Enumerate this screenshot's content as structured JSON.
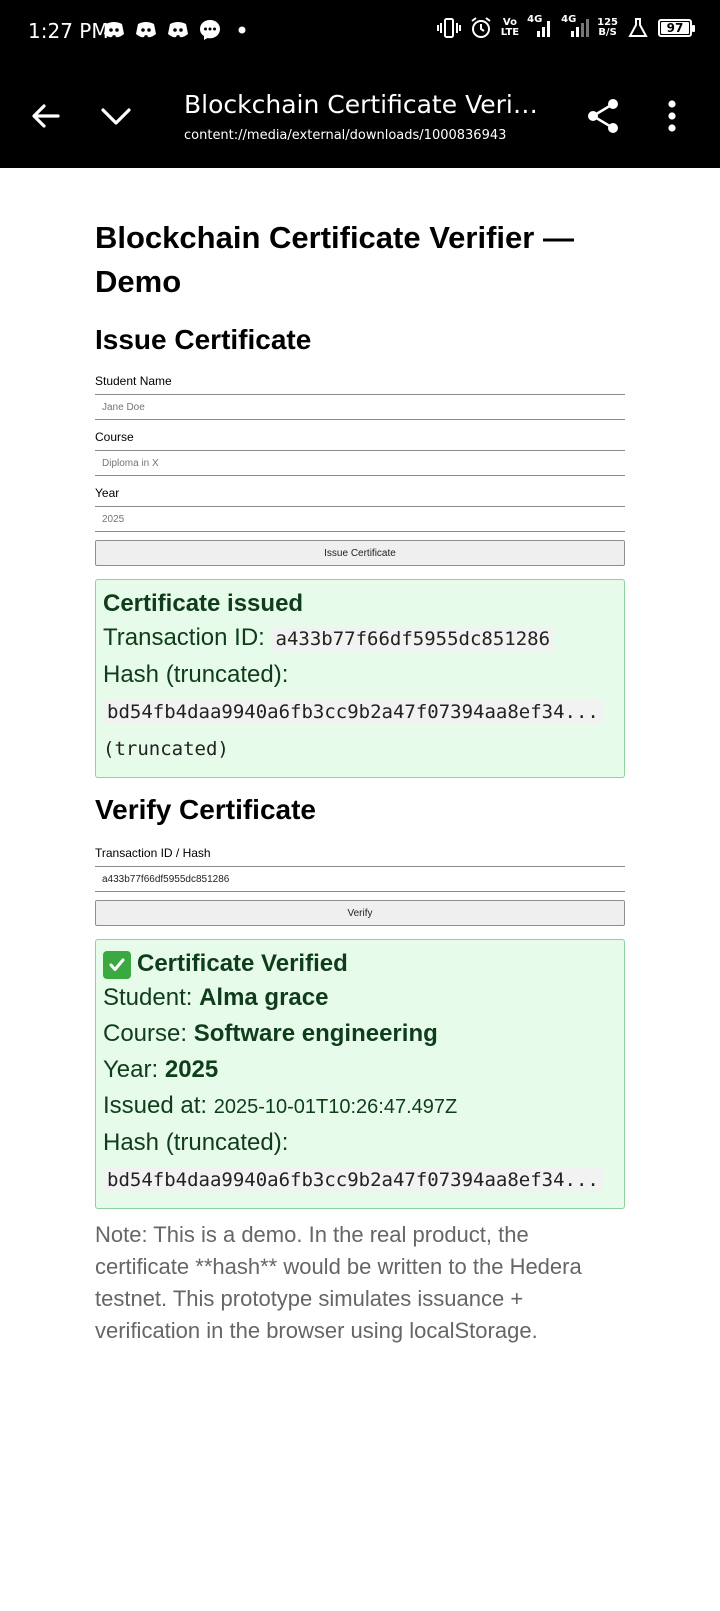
{
  "status_bar": {
    "time": "1:27 PM",
    "net1": "Vo\nLTE",
    "net2": "4G",
    "net3": "4G",
    "speed": "125\nB/S",
    "battery": "97",
    "icons": [
      "discord-icon",
      "discord-icon",
      "discord-icon",
      "messenger-icon",
      "dot-icon",
      "vibrate-icon",
      "alarm-icon",
      "signal-icon",
      "signal-icon",
      "flask-icon",
      "battery-icon"
    ]
  },
  "app_bar": {
    "title": "Blockchain Certificate Verifier — Demo",
    "url": "content://media/external/downloads/1000836943",
    "icons": [
      "back-arrow-icon",
      "chevron-down-icon",
      "share-icon",
      "more-vert-icon"
    ]
  },
  "page": {
    "title": "Blockchain Certificate Verifier — Demo",
    "issue": {
      "heading": "Issue Certificate",
      "student_label": "Student Name",
      "student_placeholder": "Jane Doe",
      "course_label": "Course",
      "course_placeholder": "Diploma in X",
      "year_label": "Year",
      "year_placeholder": "2025",
      "button": "Issue Certificate",
      "result": {
        "title": "Certificate issued",
        "txid_label": "Transaction ID:",
        "txid": "a433b77f66df5955dc851286",
        "hash_label": "Hash (truncated):",
        "hash": "bd54fb4daa9940a6fb3cc9b2a47f07394aa8ef34...",
        "hash_suffix": "(truncated)"
      }
    },
    "verify": {
      "heading": "Verify Certificate",
      "input_label": "Transaction ID / Hash",
      "input_value": "a433b77f66df5955dc851286",
      "button": "Verify",
      "result": {
        "title": "Certificate Verified",
        "student_label": "Student:",
        "student": "Alma grace",
        "course_label": "Course:",
        "course": "Software engineering",
        "year_label": "Year:",
        "year": "2025",
        "issued_label": "Issued at:",
        "issued": "2025-10-01T10:26:47.497Z",
        "hash_label": "Hash (truncated):",
        "hash": "bd54fb4daa9940a6fb3cc9b2a47f07394aa8ef34..."
      }
    },
    "note": "Note: This is a demo. In the real product, the certificate **hash** would be written to the Hedera testnet. This prototype simulates issuance + verification in the browser using localStorage."
  },
  "colors": {
    "result_bg": "#e6fbe9",
    "result_border": "#8fd19e",
    "result_text": "#0f3d1c",
    "check_green": "#3aa93f"
  }
}
